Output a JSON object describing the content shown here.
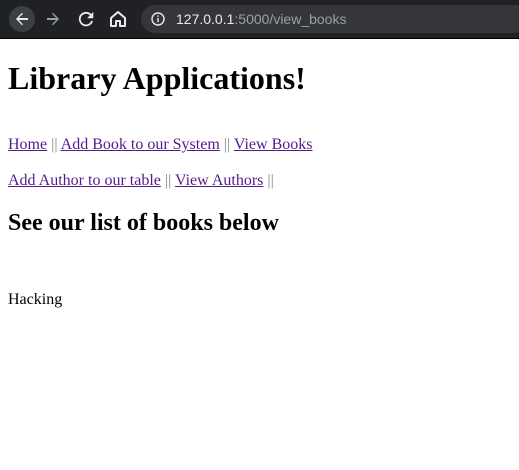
{
  "browser": {
    "url_host": "127.0.0.1",
    "url_rest": ":5000/view_books"
  },
  "page": {
    "title": "Library Applications!",
    "nav_row1": [
      {
        "label": "Home"
      },
      {
        "label": "Add Book to our System"
      },
      {
        "label": "View Books"
      }
    ],
    "nav_row2": [
      {
        "label": "Add Author to our table"
      },
      {
        "label": "View Authors"
      }
    ],
    "separator": "||",
    "subtitle": "See our list of books below",
    "books": [
      "Hacking"
    ]
  }
}
